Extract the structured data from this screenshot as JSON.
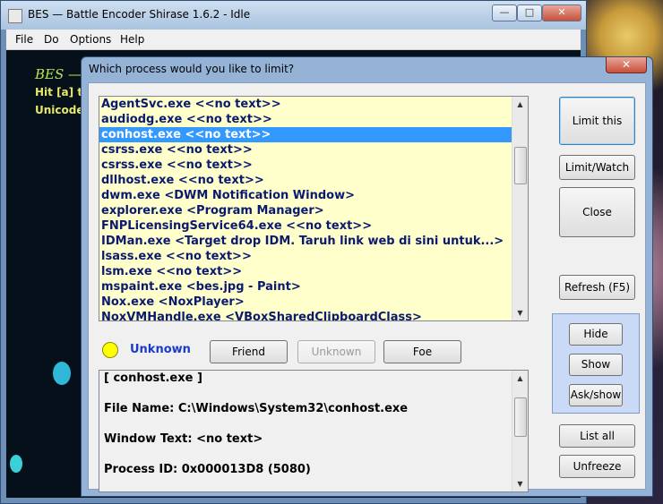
{
  "main_window": {
    "title": "BES — Battle Encoder Shirase 1.6.2 - Idle",
    "caption_buttons": {
      "minimize": "—",
      "maximize": "□",
      "close": "✕"
    },
    "menu": [
      "File",
      "Do",
      "Options",
      "Help"
    ],
    "client_text": {
      "line1": "BES —",
      "line2": "Hit [a] t",
      "line3": "Unicode"
    }
  },
  "dialog": {
    "title": "Which process would you like to limit?",
    "close_label": "✕",
    "processes": [
      "AgentSvc.exe <<no text>>",
      "audiodg.exe <<no text>>",
      "conhost.exe <<no text>>",
      "csrss.exe <<no text>>",
      "csrss.exe <<no text>>",
      "dllhost.exe <<no text>>",
      "dwm.exe <DWM Notification Window>",
      "explorer.exe <Program Manager>",
      "FNPLicensingService64.exe <<no text>>",
      "IDMan.exe <Target drop IDM. Taruh link web di sini untuk...>",
      "lsass.exe <<no text>>",
      "lsm.exe <<no text>>",
      "mspaint.exe <bes.jpg - Paint>",
      "Nox.exe <NoxPlayer>",
      "NoxVMHandle.exe <VBoxSharedClipboardClass>"
    ],
    "selected_index": 2,
    "status": {
      "label": "Unknown",
      "color": "#ffff00"
    },
    "classify_buttons": {
      "friend": "Friend",
      "unknown": "Unknown",
      "foe": "Foe"
    },
    "details": [
      "[ conhost.exe ]",
      "File Name: C:\\Windows\\System32\\conhost.exe",
      "Window Text: <no text>",
      "Process ID: 0x000013D8 (5080)"
    ],
    "buttons": {
      "limit_this": "Limit this",
      "limit_watch": "Limit/Watch",
      "close": "Close",
      "refresh": "Refresh (F5)",
      "hide": "Hide",
      "show": "Show",
      "ask_show": "Ask/show",
      "list_all": "List all",
      "unfreeze": "Unfreeze"
    }
  }
}
